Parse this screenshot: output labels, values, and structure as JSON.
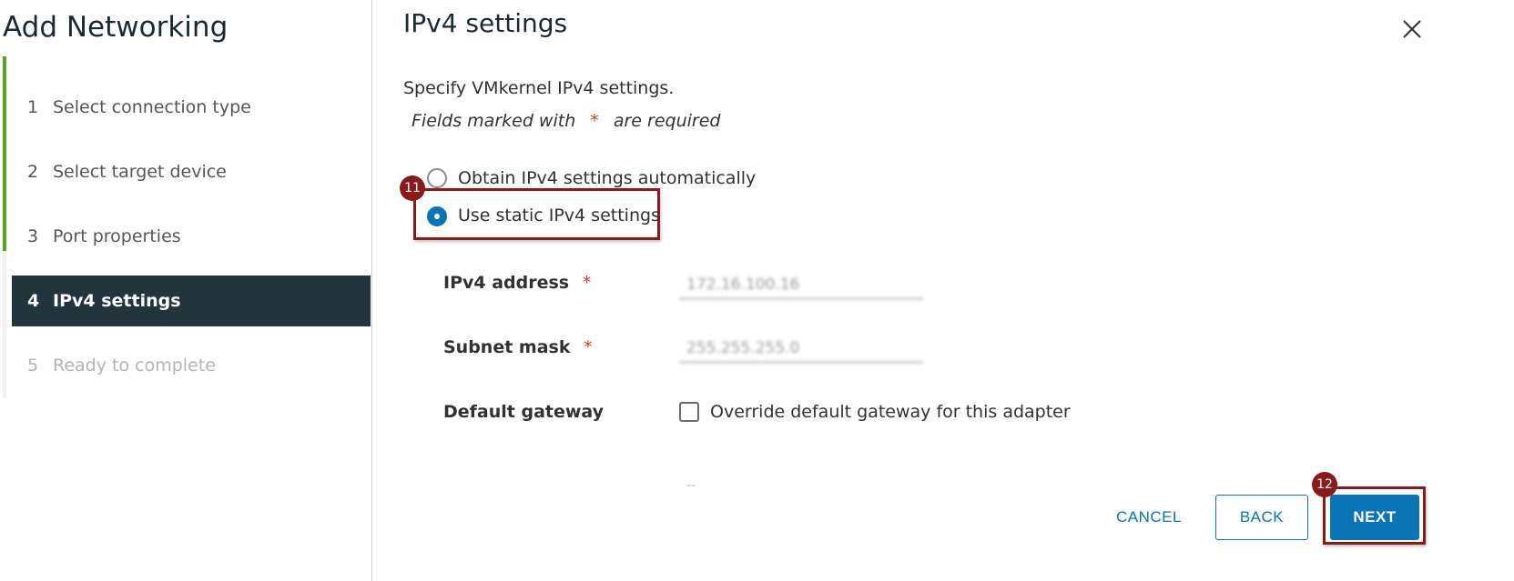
{
  "wizard": {
    "title": "Add Networking",
    "steps": [
      {
        "num": "1",
        "label": "Select connection type"
      },
      {
        "num": "2",
        "label": "Select target device"
      },
      {
        "num": "3",
        "label": "Port properties"
      },
      {
        "num": "4",
        "label": "IPv4 settings"
      },
      {
        "num": "5",
        "label": "Ready to complete"
      }
    ],
    "active_step": 4
  },
  "page": {
    "title": "IPv4 settings",
    "description": "Specify VMkernel IPv4 settings.",
    "required_note_prefix": "Fields marked with",
    "required_marker": "*",
    "required_note_suffix": "are required"
  },
  "options": {
    "auto_label": "Obtain IPv4 settings automatically",
    "static_label": "Use static IPv4 settings",
    "selected": "static"
  },
  "fields": {
    "ipv4_address": {
      "label": "IPv4 address",
      "required": "*",
      "value": "172.16.100.16"
    },
    "subnet_mask": {
      "label": "Subnet mask",
      "required": "*",
      "value": "255.255.255.0"
    },
    "default_gateway": {
      "label": "Default gateway",
      "override_label": "Override default gateway for this adapter",
      "override_checked": false,
      "placeholder": "--"
    }
  },
  "annotations": {
    "step_11": "11",
    "step_12": "12"
  },
  "buttons": {
    "cancel": "CANCEL",
    "back": "BACK",
    "next": "NEXT"
  },
  "colors": {
    "accent": "#0a74b5",
    "sidebar_active": "#22343c",
    "progress": "#5aa220",
    "annotation": "#8b1a1a",
    "required": "#d23e1b"
  },
  "icons": {
    "close": "close-icon"
  }
}
